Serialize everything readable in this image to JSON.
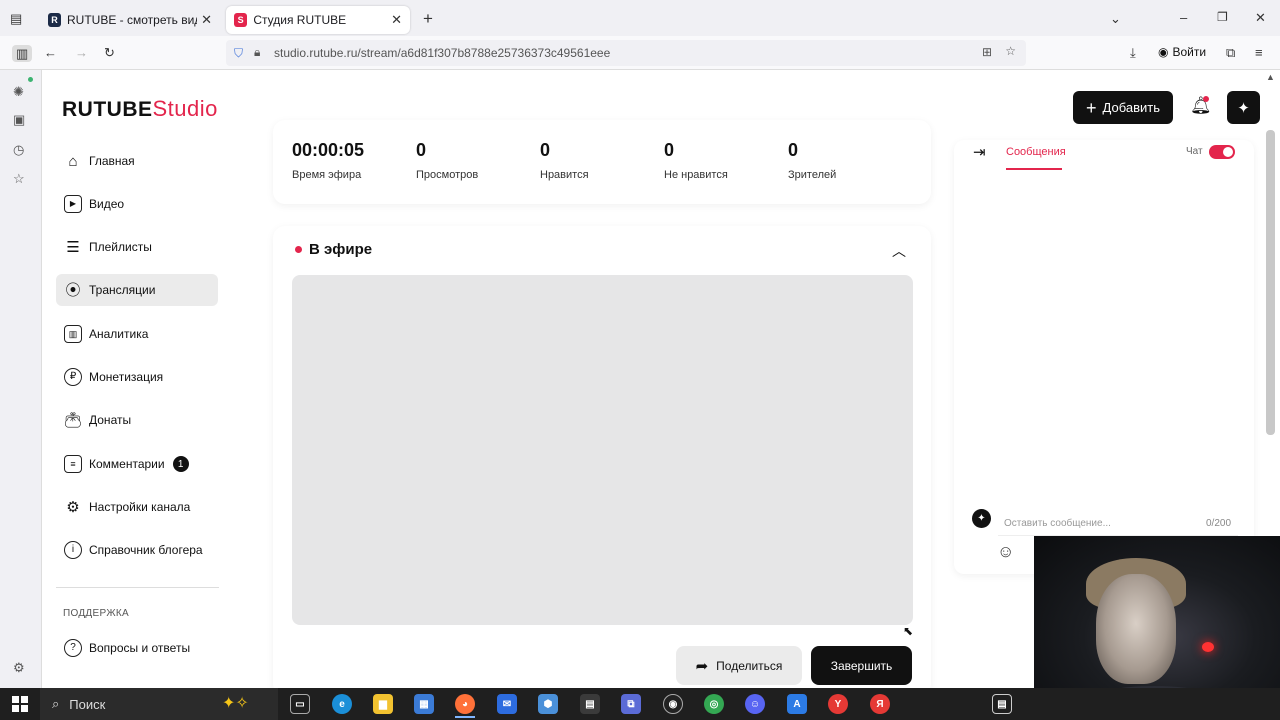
{
  "browser": {
    "tabs": [
      {
        "title": "RUTUBE - смотреть видео онл",
        "favicon": "R",
        "active": false
      },
      {
        "title": "Студия RUTUBE",
        "favicon": "S",
        "active": true
      }
    ],
    "url": "studio.rutube.ru/stream/a6d81f307b8788e25736373c49561eee",
    "login_label": "Войти"
  },
  "studio": {
    "logo_text": "RUTUBE",
    "logo_accent": "Studio",
    "add_button": "Добавить",
    "accent_color": "#e3254c"
  },
  "nav": {
    "items": [
      {
        "label": "Главная",
        "icon": "home-icon",
        "active": false
      },
      {
        "label": "Видео",
        "icon": "video-icon",
        "active": false
      },
      {
        "label": "Плейлисты",
        "icon": "playlist-icon",
        "active": false
      },
      {
        "label": "Трансляции",
        "icon": "broadcast-icon",
        "active": true
      },
      {
        "label": "Аналитика",
        "icon": "analytics-icon",
        "active": false
      },
      {
        "label": "Монетизация",
        "icon": "ruble-icon",
        "active": false
      },
      {
        "label": "Донаты",
        "icon": "wallet-icon",
        "active": false
      },
      {
        "label": "Комментарии",
        "icon": "comment-icon",
        "active": false,
        "badge": "1"
      },
      {
        "label": "Настройки канала",
        "icon": "gear-icon",
        "active": false
      },
      {
        "label": "Справочник блогера",
        "icon": "info-icon",
        "active": false
      }
    ],
    "support_section": "ПОДДЕРЖКА",
    "support_items": [
      {
        "label": "Вопросы и ответы",
        "icon": "help-icon"
      }
    ]
  },
  "stats": [
    {
      "value": "00:00:05",
      "label": "Время эфира"
    },
    {
      "value": "0",
      "label": "Просмотров"
    },
    {
      "value": "0",
      "label": "Нравится"
    },
    {
      "value": "0",
      "label": "Не нравится"
    },
    {
      "value": "0",
      "label": "Зрителей"
    }
  ],
  "live": {
    "title": "В эфире",
    "share_button": "Поделиться",
    "end_button": "Завершить"
  },
  "chat": {
    "tab_messages": "Сообщения",
    "toggle_label": "Чат",
    "toggle_on": true,
    "input_placeholder": "Оставить сообщение...",
    "char_count": "0/200"
  },
  "taskbar": {
    "search_label": "Поиск"
  }
}
